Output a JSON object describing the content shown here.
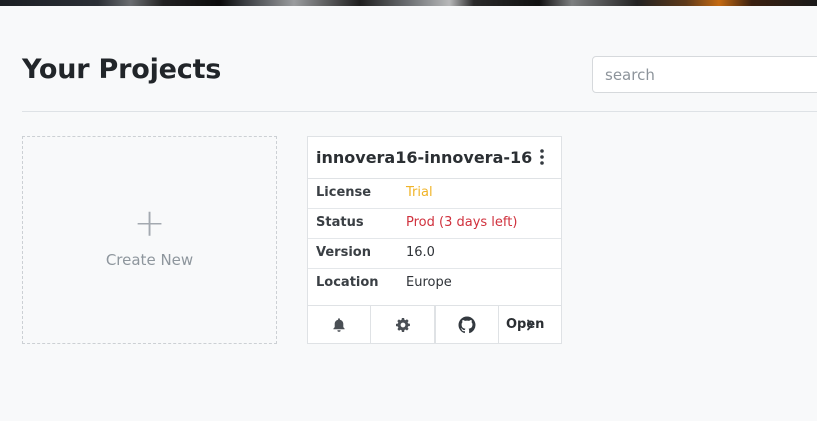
{
  "header": {
    "title": "Your Projects",
    "search_placeholder": "search"
  },
  "create_new": {
    "plus": "+",
    "label": "Create New"
  },
  "project": {
    "title": "innovera16-innovera-16",
    "fields": [
      {
        "label": "License",
        "value": "Trial",
        "color": "#f0b429"
      },
      {
        "label": "Status",
        "value": "Prod (3 days left)",
        "color": "#d0313d"
      },
      {
        "label": "Version",
        "value": "16.0"
      },
      {
        "label": "Location",
        "value": "Europe"
      }
    ],
    "actions": {
      "notifications_icon": "bell-icon",
      "settings_icon": "gear-icon",
      "repo_icon": "github-icon",
      "open_label": "Open",
      "open_icon": "chevron-right-icon"
    }
  }
}
